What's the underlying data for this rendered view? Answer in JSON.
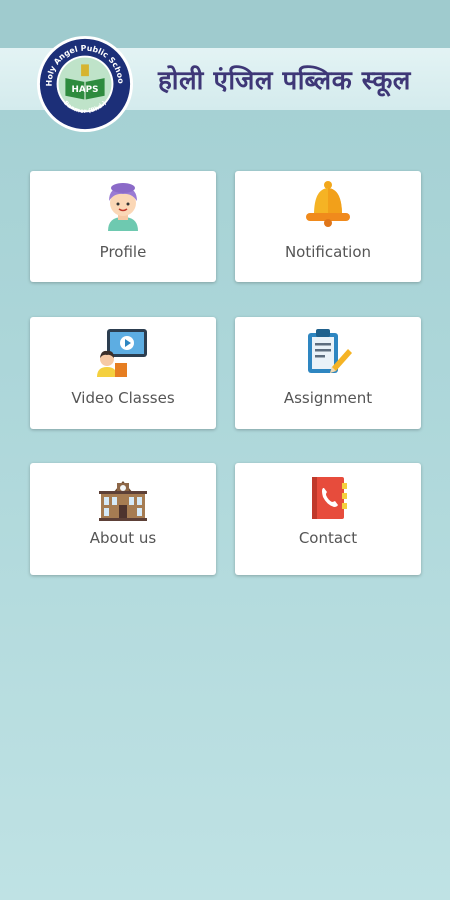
{
  "header": {
    "title": "होली एंजिल पब्लिक स्कूल",
    "logo_text_top": "Holy Angel Public School",
    "logo_text_bottom": "Banmor (Bhd.)",
    "logo_center": "HAPS"
  },
  "menu": [
    {
      "label": "Profile",
      "icon": "child-avatar-icon"
    },
    {
      "label": "Notification",
      "icon": "bell-icon"
    },
    {
      "label": "Video Classes",
      "icon": "video-lesson-icon"
    },
    {
      "label": "Assignment",
      "icon": "clipboard-pencil-icon"
    },
    {
      "label": "About us",
      "icon": "school-building-icon"
    },
    {
      "label": "Contact",
      "icon": "phone-book-icon"
    }
  ],
  "colors": {
    "title": "#3e3777",
    "background": "#acd6d9",
    "card": "#ffffff"
  }
}
